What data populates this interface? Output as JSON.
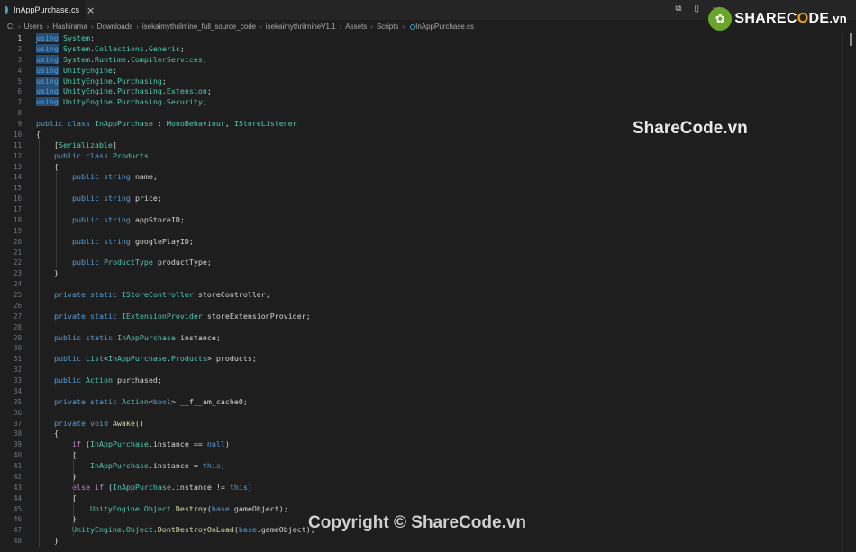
{
  "tab": {
    "label": "InAppPurchase.cs",
    "close": "×"
  },
  "breadcrumb": [
    "C:",
    "Users",
    "Hashirama",
    "Downloads",
    "isekaimythrilmine_full_source_code",
    "isekaimythrilmineV1.1",
    "Assets",
    "Scripts",
    "InAppPurchase.cs"
  ],
  "window_controls": [
    "⧉",
    "▯",
    "⋯"
  ],
  "watermarks": {
    "logo_prefix": "SHAREC",
    "logo_o": "O",
    "logo_suffix": "DE",
    "logo_vn": ".vn",
    "center": "ShareCode.vn",
    "copyright": "Copyright © ShareCode.vn"
  },
  "code_lines": [
    "using System;",
    "using System.Collections.Generic;",
    "using System.Runtime.CompilerServices;",
    "using UnityEngine;",
    "using UnityEngine.Purchasing;",
    "using UnityEngine.Purchasing.Extension;",
    "using UnityEngine.Purchasing.Security;",
    "",
    "public class InAppPurchase : MonoBehaviour, IStoreListener",
    "{",
    "    [Serializable]",
    "    public class Products",
    "    {",
    "        public string name;",
    "",
    "        public string price;",
    "",
    "        public string appStoreID;",
    "",
    "        public string googlePlayID;",
    "",
    "        public ProductType productType;",
    "    }",
    "",
    "    private static IStoreController storeController;",
    "",
    "    private static IExtensionProvider storeExtensionProvider;",
    "",
    "    public static InAppPurchase instance;",
    "",
    "    public List<InAppPurchase.Products> products;",
    "",
    "    public Action purchased;",
    "",
    "    private static Action<bool> __f__am_cache0;",
    "",
    "    private void Awake()",
    "    {",
    "        if (InAppPurchase.instance == null)",
    "        {",
    "            InAppPurchase.instance = this;",
    "        }",
    "        else if (InAppPurchase.instance != this)",
    "        {",
    "            UnityEngine.Object.Destroy(base.gameObject);",
    "        }",
    "        UnityEngine.Object.DontDestroyOnLoad(base.gameObject);",
    "    }"
  ]
}
